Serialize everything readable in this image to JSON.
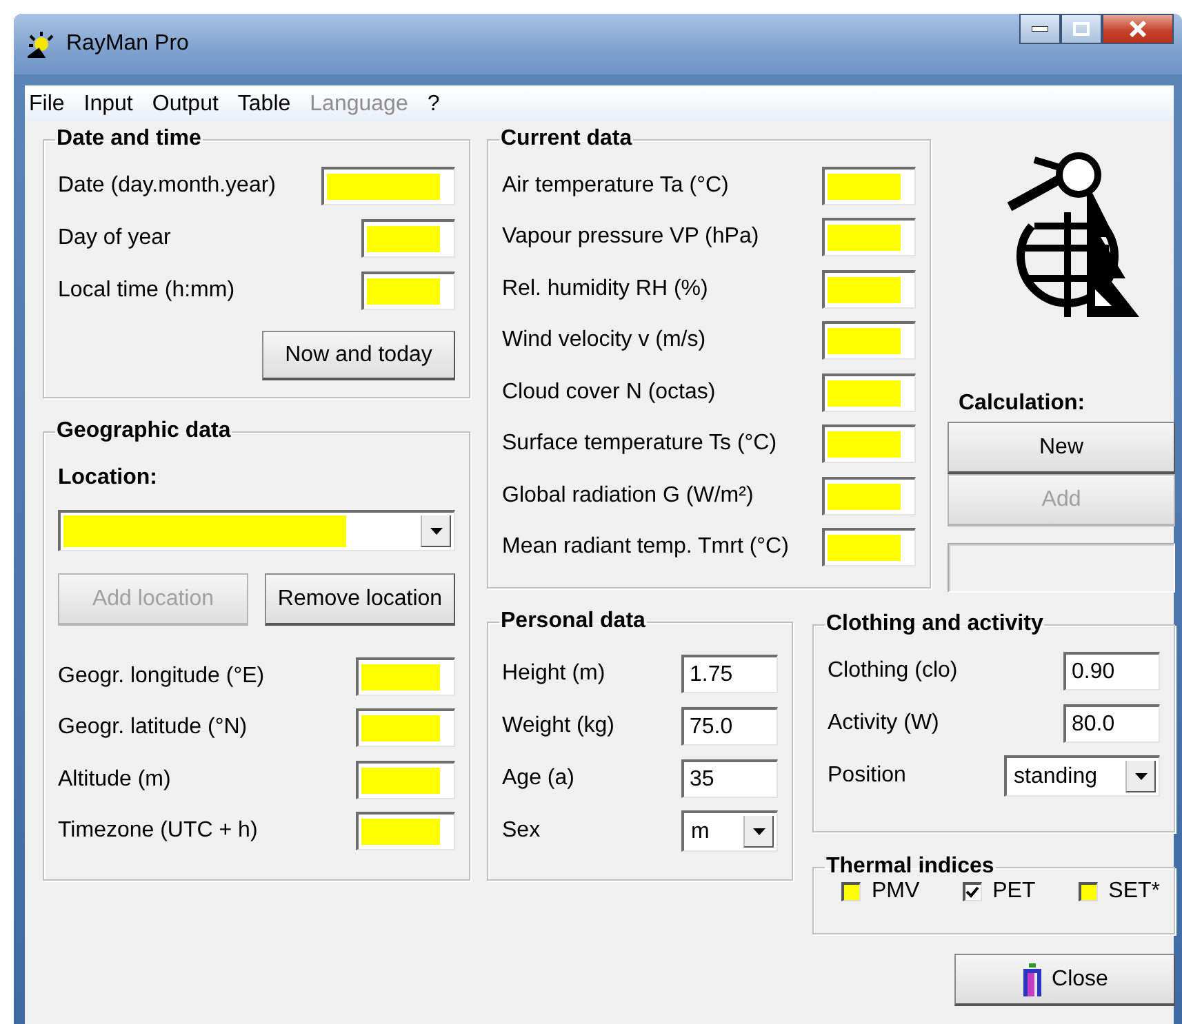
{
  "window": {
    "title": "RayMan Pro"
  },
  "menu": [
    {
      "label": "File",
      "disabled": false
    },
    {
      "label": "Input",
      "disabled": false
    },
    {
      "label": "Output",
      "disabled": false
    },
    {
      "label": "Table",
      "disabled": false
    },
    {
      "label": "Language",
      "disabled": true
    },
    {
      "label": "?",
      "disabled": false
    }
  ],
  "date_and_time": {
    "title": "Date and time",
    "fields": [
      {
        "label": "Date (day.month.year)",
        "highlighted": true
      },
      {
        "label": "Day of year",
        "highlighted": true
      },
      {
        "label": "Local time (h:mm)",
        "highlighted": true
      }
    ],
    "button": {
      "label": "Now and today",
      "disabled": false
    }
  },
  "geographic_data": {
    "title": "Geographic data",
    "location_label": "Location:",
    "location_combo": {
      "highlighted": true
    },
    "buttons": [
      {
        "label": "Add location",
        "disabled": true
      },
      {
        "label": "Remove location",
        "disabled": false
      }
    ],
    "fields": [
      {
        "label": "Geogr. longitude (°E)",
        "highlighted": true
      },
      {
        "label": "Geogr. latitude (°N)",
        "highlighted": true
      },
      {
        "label": "Altitude (m)",
        "highlighted": true
      },
      {
        "label": "Timezone (UTC + h)",
        "highlighted": true
      }
    ]
  },
  "current_data": {
    "title": "Current data",
    "fields": [
      {
        "label": "Air temperature Ta (°C)",
        "highlighted": true
      },
      {
        "label": "Vapour pressure VP (hPa)",
        "highlighted": true
      },
      {
        "label": "Rel. humidity RH (%)",
        "highlighted": true
      },
      {
        "label": "Wind velocity v (m/s)",
        "highlighted": true
      },
      {
        "label": "Cloud cover N (octas)",
        "highlighted": true
      },
      {
        "label": "Surface temperature Ts (°C)",
        "highlighted": true
      },
      {
        "label": "Global radiation G (W/m²)",
        "highlighted": true
      },
      {
        "label": "Mean radiant temp. Tmrt (°C)",
        "highlighted": true
      }
    ]
  },
  "calculation": {
    "label": "Calculation:",
    "buttons": [
      {
        "label": "New",
        "disabled": false
      },
      {
        "label": "Add",
        "disabled": true
      }
    ]
  },
  "personal_data": {
    "title": "Personal data",
    "fields": [
      {
        "label": "Height (m)",
        "value": "1.75"
      },
      {
        "label": "Weight (kg)",
        "value": "75.0"
      },
      {
        "label": "Age (a)",
        "value": "35"
      }
    ],
    "sex": {
      "label": "Sex",
      "value": "m"
    }
  },
  "clothing_and_activity": {
    "title": "Clothing and activity",
    "fields": [
      {
        "label": "Clothing (clo)",
        "value": "0.90"
      },
      {
        "label": "Activity (W)",
        "value": "80.0"
      }
    ],
    "position": {
      "label": "Position",
      "value": "standing"
    }
  },
  "thermal_indices": {
    "title": "Thermal indices",
    "options": [
      {
        "label": "PMV",
        "checked": false
      },
      {
        "label": "PET",
        "checked": true
      },
      {
        "label": "SET*",
        "checked": false
      }
    ]
  },
  "close_button": {
    "label": "Close"
  }
}
